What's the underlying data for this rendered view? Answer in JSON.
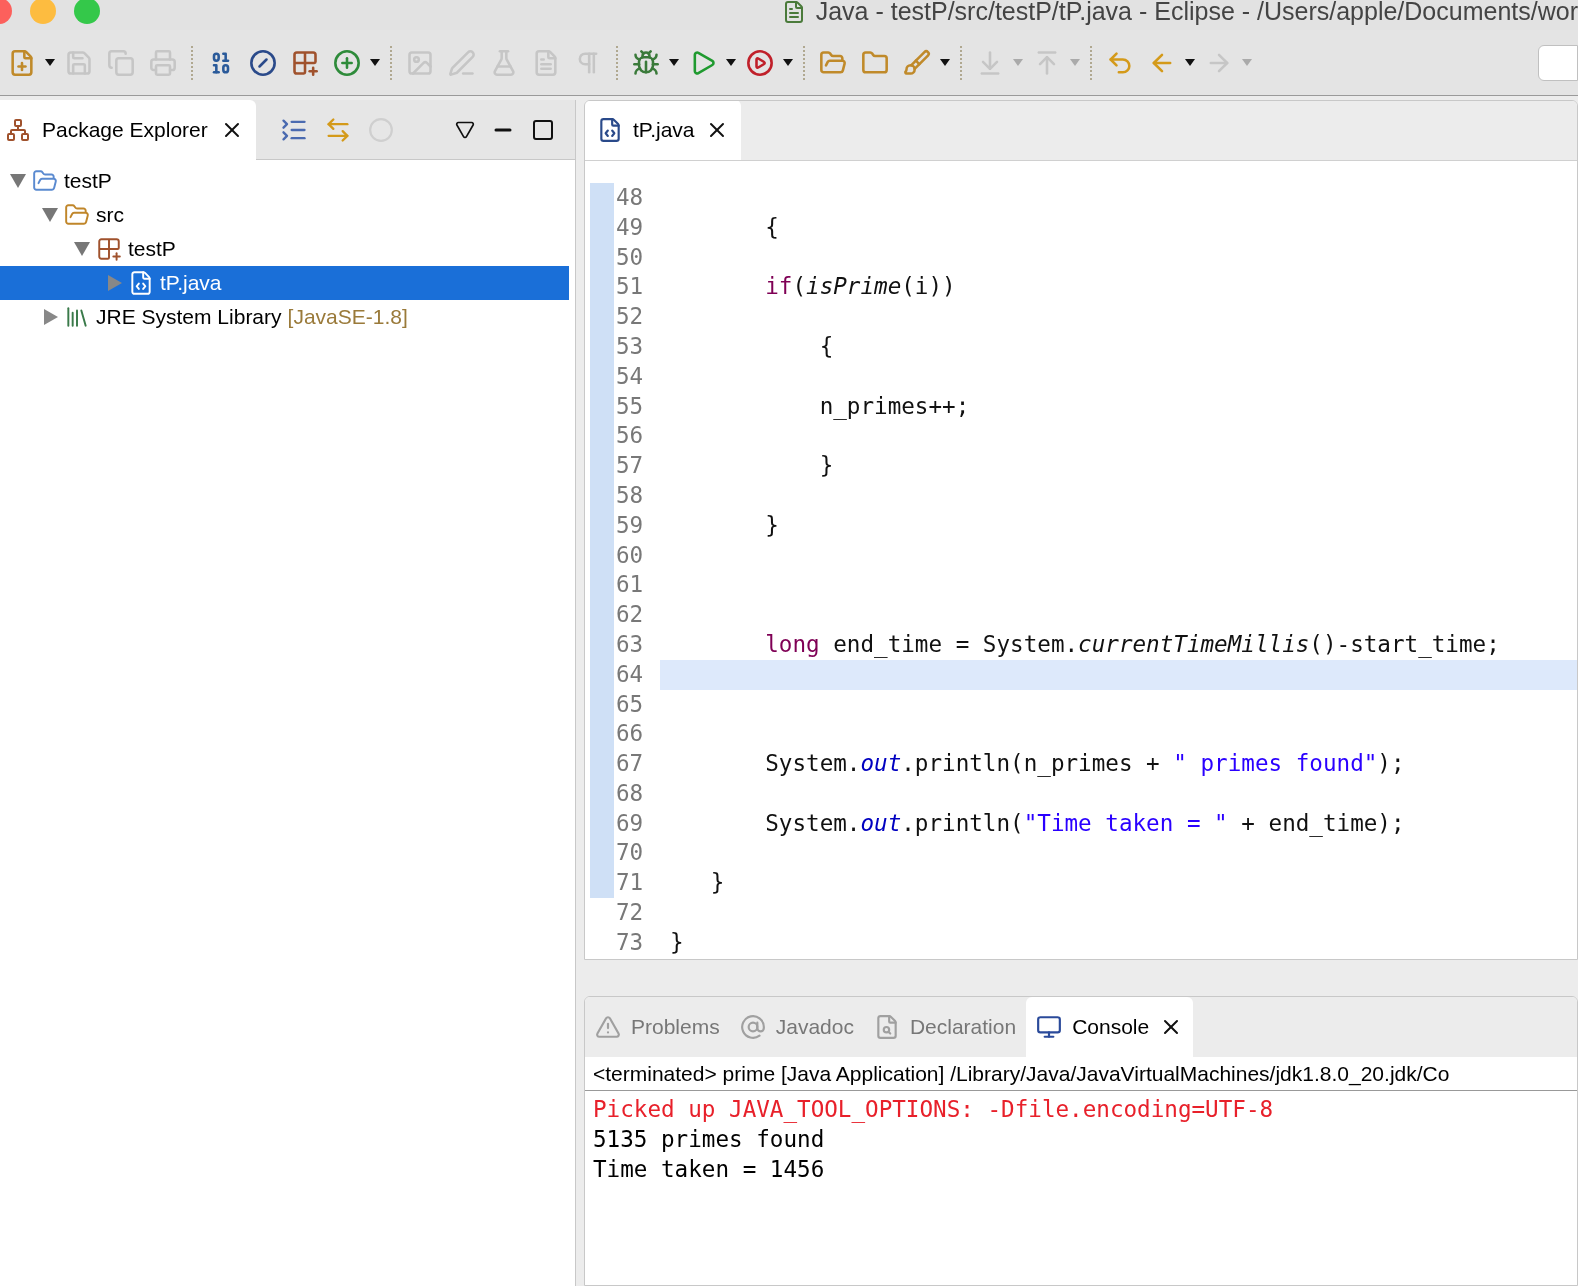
{
  "window": {
    "title": "Java - testP/src/testP/tP.java - Eclipse - /Users/apple/Documents/wor"
  },
  "toolbar": {
    "buttons": [
      {
        "disabled": false,
        "dropdown": true
      },
      {
        "disabled": true,
        "dropdown": false
      },
      {
        "disabled": true,
        "dropdown": false
      },
      {
        "disabled": true,
        "dropdown": false
      },
      {
        "disabled": false,
        "dropdown": false
      },
      {
        "disabled": false,
        "dropdown": false
      },
      {
        "disabled": false,
        "dropdown": false
      },
      {
        "disabled": false,
        "dropdown": true
      },
      {
        "disabled": true,
        "dropdown": false
      },
      {
        "disabled": true,
        "dropdown": false
      },
      {
        "disabled": true,
        "dropdown": false
      },
      {
        "disabled": true,
        "dropdown": false
      },
      {
        "disabled": true,
        "dropdown": false
      },
      {
        "disabled": false,
        "dropdown": true
      },
      {
        "disabled": false,
        "dropdown": true
      },
      {
        "disabled": false,
        "dropdown": true
      },
      {
        "disabled": false,
        "dropdown": false
      },
      {
        "disabled": false,
        "dropdown": false
      },
      {
        "disabled": false,
        "dropdown": true
      },
      {
        "disabled": true,
        "dropdown": true
      },
      {
        "disabled": true,
        "dropdown": true
      },
      {
        "disabled": false,
        "dropdown": false
      },
      {
        "disabled": false,
        "dropdown": true
      },
      {
        "disabled": true,
        "dropdown": true
      }
    ]
  },
  "package_explorer": {
    "tab": {
      "label": "Package Explorer",
      "selected": true
    },
    "tree": [
      {
        "kind": "project",
        "label": "testP",
        "expanded": true,
        "selected": false,
        "children": [
          {
            "kind": "source-folder",
            "label": "src",
            "expanded": true,
            "selected": false,
            "children": [
              {
                "kind": "package",
                "label": "testP",
                "expanded": true,
                "selected": false,
                "children": [
                  {
                    "kind": "java-file",
                    "label": "tP.java",
                    "expanded": false,
                    "selected": true
                  }
                ]
              }
            ]
          },
          {
            "kind": "library",
            "label": "JRE System Library",
            "suffix": "[JavaSE-1.8]",
            "expanded": false,
            "selected": false
          }
        ]
      }
    ]
  },
  "editor": {
    "tab": {
      "label": "tP.java",
      "selected": true
    },
    "lines": [
      {
        "number": "48",
        "changed": true,
        "current": false
      },
      {
        "number": "49",
        "changed": true,
        "current": false,
        "tokens": [
          {
            "kind": "plain",
            "text": "       {"
          }
        ]
      },
      {
        "number": "50",
        "changed": true,
        "current": false
      },
      {
        "number": "51",
        "changed": true,
        "current": false,
        "tokens": [
          {
            "kind": "keyword",
            "text": "       if"
          },
          {
            "kind": "plain",
            "text": "("
          },
          {
            "kind": "method",
            "text": "isPrime"
          },
          {
            "kind": "plain",
            "text": "(i))"
          }
        ]
      },
      {
        "number": "52",
        "changed": true,
        "current": false
      },
      {
        "number": "53",
        "changed": true,
        "current": false,
        "tokens": [
          {
            "kind": "plain",
            "text": "           {"
          }
        ]
      },
      {
        "number": "54",
        "changed": true,
        "current": false
      },
      {
        "number": "55",
        "changed": true,
        "current": false,
        "tokens": [
          {
            "kind": "plain",
            "text": "           n_primes++;"
          }
        ]
      },
      {
        "number": "56",
        "changed": true,
        "current": false
      },
      {
        "number": "57",
        "changed": true,
        "current": false,
        "tokens": [
          {
            "kind": "plain",
            "text": "           }"
          }
        ]
      },
      {
        "number": "58",
        "changed": true,
        "current": false
      },
      {
        "number": "59",
        "changed": true,
        "current": false,
        "tokens": [
          {
            "kind": "plain",
            "text": "       }"
          }
        ]
      },
      {
        "number": "60",
        "changed": true,
        "current": false
      },
      {
        "number": "61",
        "changed": true,
        "current": false
      },
      {
        "number": "62",
        "changed": true,
        "current": false
      },
      {
        "number": "63",
        "changed": true,
        "current": false,
        "tokens": [
          {
            "kind": "keyword",
            "text": "       long"
          },
          {
            "kind": "plain",
            "text": " end_time = System."
          },
          {
            "kind": "method",
            "text": "currentTimeMillis"
          },
          {
            "kind": "plain",
            "text": "()-start_time;"
          }
        ]
      },
      {
        "number": "64",
        "changed": true,
        "current": true
      },
      {
        "number": "65",
        "changed": true,
        "current": false
      },
      {
        "number": "66",
        "changed": true,
        "current": false
      },
      {
        "number": "67",
        "changed": true,
        "current": false,
        "tokens": [
          {
            "kind": "plain",
            "text": "       System."
          },
          {
            "kind": "field",
            "text": "out"
          },
          {
            "kind": "plain",
            "text": ".println(n_primes + "
          },
          {
            "kind": "string",
            "text": "\" primes found\""
          },
          {
            "kind": "plain",
            "text": ");"
          }
        ]
      },
      {
        "number": "68",
        "changed": true,
        "current": false
      },
      {
        "number": "69",
        "changed": true,
        "current": false,
        "tokens": [
          {
            "kind": "plain",
            "text": "       System."
          },
          {
            "kind": "field",
            "text": "out"
          },
          {
            "kind": "plain",
            "text": ".println("
          },
          {
            "kind": "string",
            "text": "\"Time taken = \""
          },
          {
            "kind": "plain",
            "text": " + end_time);"
          }
        ]
      },
      {
        "number": "70",
        "changed": true,
        "current": false
      },
      {
        "number": "71",
        "changed": true,
        "current": false,
        "tokens": [
          {
            "kind": "plain",
            "text": "   }"
          }
        ]
      },
      {
        "number": "72",
        "changed": false,
        "current": false
      },
      {
        "number": "73",
        "changed": false,
        "current": false,
        "tokens": [
          {
            "kind": "plain",
            "text": "}"
          }
        ]
      }
    ]
  },
  "bottom_panel": {
    "tabs": [
      {
        "kind": "problems",
        "label": "Problems",
        "selected": false
      },
      {
        "kind": "javadoc",
        "label": "Javadoc",
        "selected": false
      },
      {
        "kind": "declaration",
        "label": "Declaration",
        "selected": false
      },
      {
        "kind": "console",
        "label": "Console",
        "selected": true
      }
    ],
    "console": {
      "header": "<terminated> prime [Java Application] /Library/Java/JavaVirtualMachines/jdk1.8.0_20.jdk/Co",
      "lines": [
        {
          "kind": "stderr",
          "text": "Picked up JAVA_TOOL_OPTIONS: -Dfile.encoding=UTF-8"
        },
        {
          "kind": "stdout",
          "text": "5135 primes found"
        },
        {
          "kind": "stdout",
          "text": "Time taken = 1456"
        }
      ]
    }
  }
}
